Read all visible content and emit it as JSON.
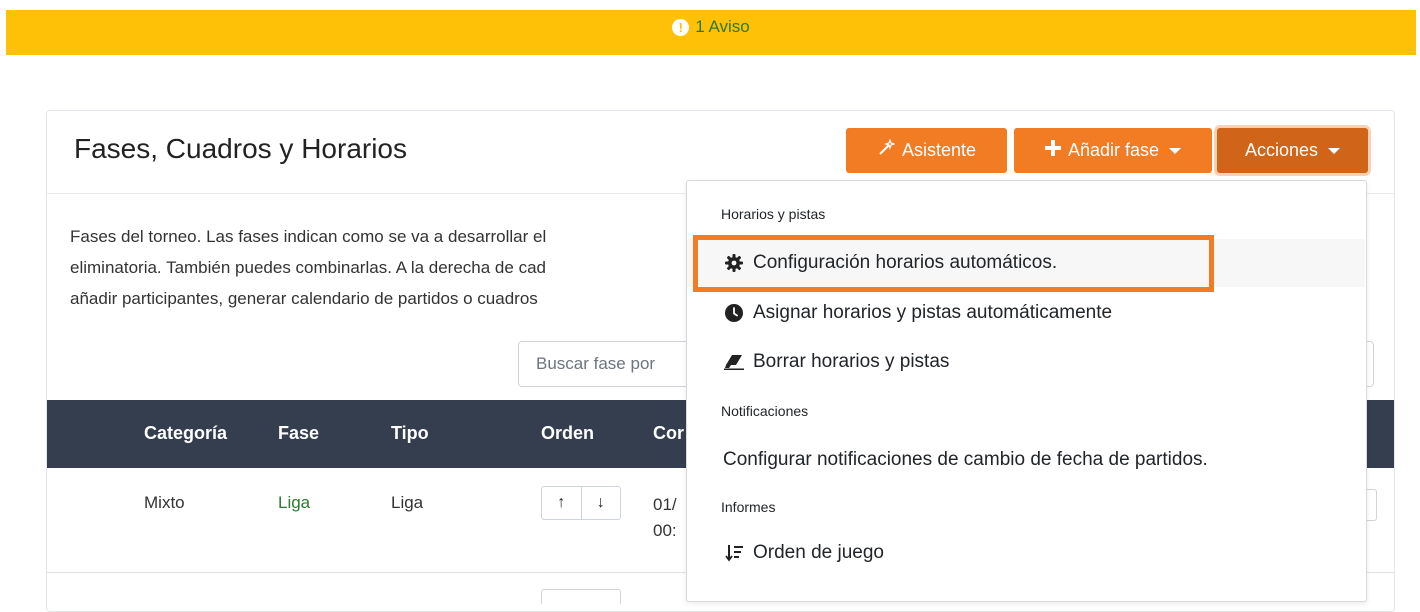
{
  "alert": {
    "icon": "exclamation-circle-icon",
    "text": "1 Aviso"
  },
  "card": {
    "title": "Fases, Cuadros y Horarios",
    "buttons": {
      "asistente": {
        "icon": "magic-wand-icon",
        "label": "Asistente"
      },
      "anadir": {
        "icon": "plus-icon",
        "label": "Añadir fase"
      },
      "acciones": {
        "label": "Acciones"
      }
    },
    "description": [
      "Fases del torneo. Las fases indican como se va a desarrollar el",
      "eliminatoria. También puedes combinarlas. A la derecha de cad",
      "añadir participantes, generar calendario de partidos o cuadros"
    ],
    "search_placeholder": "Buscar fase por"
  },
  "table": {
    "headers": [
      "Categoría",
      "Fase",
      "Tipo",
      "Orden",
      "Cor"
    ],
    "rows": [
      {
        "categoria": "Mixto",
        "fase": "Liga",
        "tipo": "Liga",
        "date_line1": "01/",
        "date_line2": "00:"
      }
    ]
  },
  "menu": {
    "sections": [
      {
        "header": "Horarios y pistas",
        "items": [
          {
            "icon": "gear-icon",
            "label": "Configuración horarios automáticos."
          },
          {
            "icon": "clock-icon",
            "label": "Asignar horarios y pistas automáticamente"
          },
          {
            "icon": "eraser-icon",
            "label": "Borrar horarios y pistas"
          }
        ]
      },
      {
        "header": "Notificaciones",
        "items": [
          {
            "label": "Configurar notificaciones de cambio de fecha de partidos."
          }
        ]
      },
      {
        "header": "Informes",
        "items": [
          {
            "icon": "sort-order-icon",
            "label": "Orden de juego"
          }
        ]
      }
    ]
  },
  "colors": {
    "alert": "#ffc107",
    "accent": "#f27c24",
    "accent_dark": "#d06418",
    "table_header": "#343e4f",
    "link_green": "#2d7a2d"
  }
}
